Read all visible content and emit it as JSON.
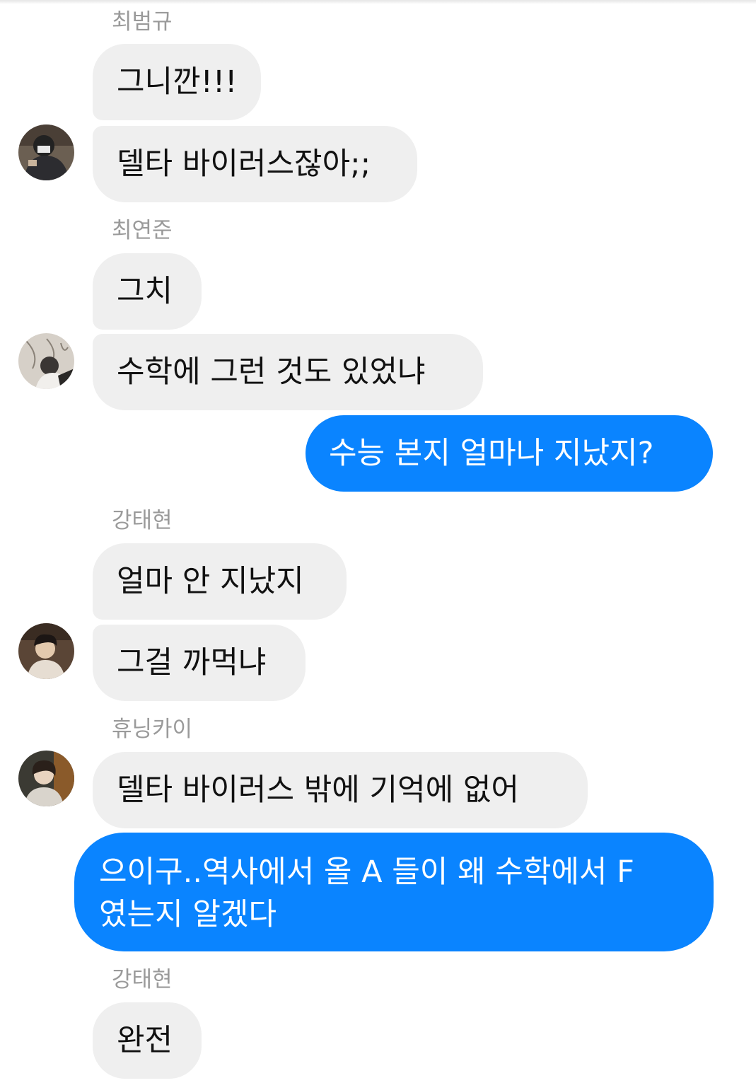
{
  "colors": {
    "incoming_bubble": "#efefef",
    "outgoing_bubble": "#0a84ff",
    "sender_name": "#9a9a9a"
  },
  "messages": [
    {
      "type": "sender",
      "text": "최범규"
    },
    {
      "type": "incoming",
      "text": "그니깐!!!"
    },
    {
      "type": "incoming",
      "text": "델타 바이러스잖아;;",
      "avatar": "user-avatar-icon"
    },
    {
      "type": "sender",
      "text": "최연준"
    },
    {
      "type": "incoming",
      "text": "그치"
    },
    {
      "type": "incoming",
      "text": "수학에 그런 것도 있었냐",
      "avatar": "user-avatar-icon"
    },
    {
      "type": "outgoing",
      "text": "수능 본지 얼마나 지났지?"
    },
    {
      "type": "sender",
      "text": "강태현"
    },
    {
      "type": "incoming",
      "text": "얼마 안 지났지"
    },
    {
      "type": "incoming",
      "text": "그걸 까먹냐",
      "avatar": "user-avatar-icon"
    },
    {
      "type": "sender",
      "text": "휴닝카이"
    },
    {
      "type": "incoming",
      "text": "델타 바이러스 밖에 기억에 없어",
      "avatar": "user-avatar-icon"
    },
    {
      "type": "outgoing",
      "lines": [
        "으이구..역사에서 올 A 들이 왜 수학에서 F",
        "였는지 알겠다"
      ]
    },
    {
      "type": "sender",
      "text": "강태현"
    },
    {
      "type": "incoming",
      "text": "완전"
    }
  ]
}
